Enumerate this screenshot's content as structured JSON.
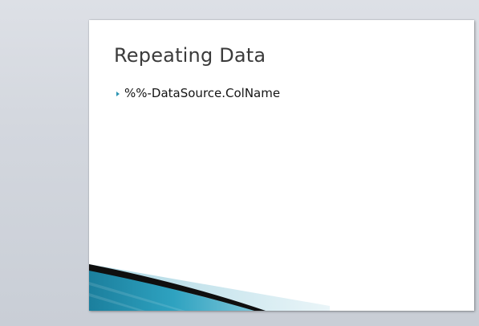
{
  "slide": {
    "title": "Repeating Data",
    "bullets": [
      {
        "text": "%%-DataSource.ColName"
      }
    ]
  },
  "colors": {
    "workspace_background": "#d3d7de",
    "slide_background": "#ffffff",
    "title_text": "#3b3b3b",
    "bullet_accent": "#2e96b4",
    "swoosh_teal": "#1f8aa8",
    "swoosh_dark": "#0d0d0d",
    "swoosh_light": "#cfe6ee"
  },
  "icons": {
    "bullet": "triangle-bullet-icon"
  }
}
